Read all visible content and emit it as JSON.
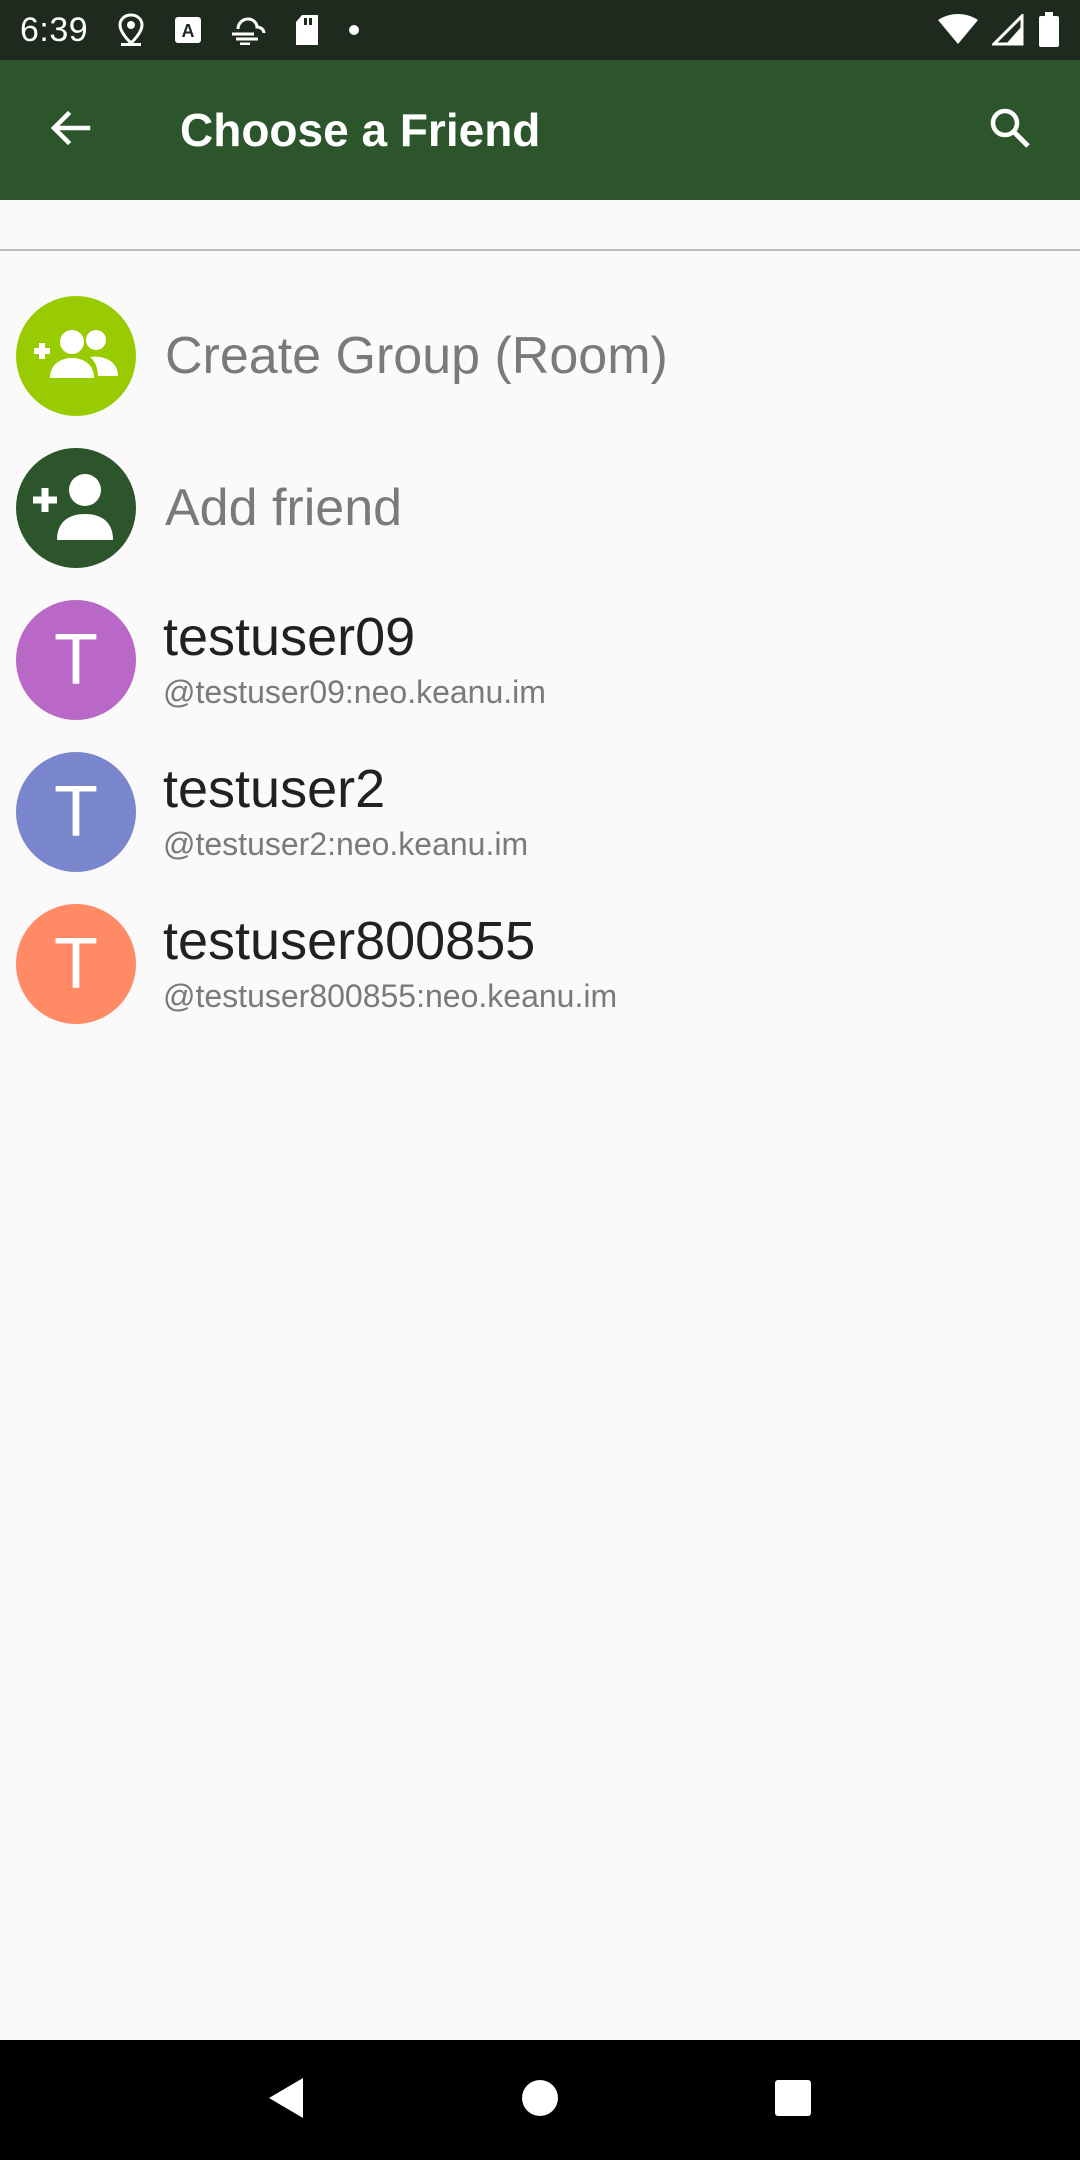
{
  "status_bar": {
    "time": "6:39",
    "left_icons": [
      "location-pin-icon",
      "a-text-icon",
      "cloud-wind-icon",
      "sd-card-icon",
      "dot-icon"
    ],
    "right_icons": [
      "wifi-icon",
      "signal-icon",
      "battery-icon"
    ]
  },
  "app_bar": {
    "title": "Choose a Friend",
    "back_icon": "arrow-back-icon",
    "search_icon": "search-icon",
    "background": "#2d552c"
  },
  "actions": [
    {
      "label": "Create Group (Room)",
      "icon": "group-add-icon",
      "color": "#99cc00"
    },
    {
      "label": "Add friend",
      "icon": "person-add-icon",
      "color": "#2d552c"
    }
  ],
  "contacts": [
    {
      "initial": "T",
      "name": "testuser09",
      "handle": "@testuser09:neo.keanu.im",
      "color": "#ba68c8"
    },
    {
      "initial": "T",
      "name": "testuser2",
      "handle": "@testuser2:neo.keanu.im",
      "color": "#7986cb"
    },
    {
      "initial": "T",
      "name": "testuser800855",
      "handle": "@testuser800855:neo.keanu.im",
      "color": "#ff8a65"
    }
  ],
  "nav_bar": {
    "buttons": [
      "back-triangle-icon",
      "home-circle-icon",
      "recents-square-icon"
    ]
  }
}
